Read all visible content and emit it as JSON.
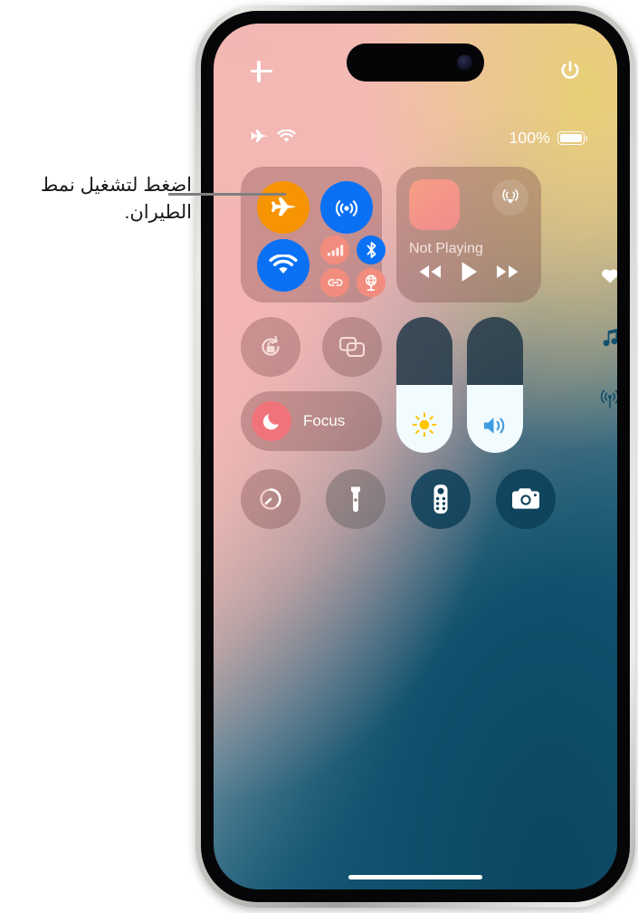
{
  "annotation": {
    "text": "اضغط لتشغيل نمط الطيران.",
    "leader_color": "#7f7f7f"
  },
  "device": {
    "name": "iPhone",
    "dynamic_island": "dynamic-island",
    "side_buttons": [
      "action-button",
      "volume-up-button",
      "volume-down-button",
      "side-button"
    ],
    "home_indicator": "home-indicator"
  },
  "screen": {
    "wallpaper_colors": {
      "top_left": "#f2b9b6",
      "top_right": "#e8cf76",
      "bottom_right": "#0c3f59",
      "mid_blue": "#2b6b86"
    }
  },
  "top_row": {
    "add_label": "+",
    "add_name": "add-controls-button",
    "power_name": "power-button"
  },
  "status_bar": {
    "airplane_icon": "airplane-icon",
    "wifi_icon": "wifi-icon",
    "battery_percent": "100%",
    "battery_icon": "battery-icon",
    "battery_level": 100
  },
  "connectivity": {
    "title": "connectivity-tile",
    "airplane": {
      "label": "Airplane Mode",
      "icon": "airplane-icon",
      "state": "on",
      "color": "#F69401"
    },
    "airdrop": {
      "label": "AirDrop",
      "icon": "airdrop-icon",
      "state": "on",
      "color": "#0A71F5"
    },
    "wifi": {
      "label": "Wi-Fi",
      "icon": "wifi-icon",
      "state": "on",
      "color": "#0A71F5"
    },
    "cellular": {
      "label": "Cellular Data",
      "icon": "cellular-bars-icon",
      "state": "off",
      "color": "#F28C7E"
    },
    "bluetooth": {
      "label": "Bluetooth",
      "icon": "bluetooth-icon",
      "state": "on",
      "color": "#0A71F5"
    },
    "hotspot": {
      "label": "Personal Hotspot",
      "icon": "hotspot-link-icon",
      "state": "off",
      "color": "#F28C7E"
    },
    "vpn": {
      "label": "VPN",
      "icon": "vpn-globe-icon",
      "state": "off",
      "color": "#F28C7E"
    }
  },
  "media": {
    "status_text": "Not Playing",
    "album_art": "album-art-placeholder",
    "airplay_icon": "airplay-icon",
    "rewind": "rewind-button",
    "play": "play-button",
    "forward": "fast-forward-button"
  },
  "controls": {
    "rotation_lock": {
      "label": "Rotation Lock",
      "icon": "rotation-lock-icon"
    },
    "screen_mirroring": {
      "label": "Screen Mirroring",
      "icon": "screen-mirroring-icon"
    },
    "focus": {
      "label": "Focus",
      "icon": "moon-icon",
      "accent": "#F0737A"
    },
    "timer": {
      "label": "Timer",
      "icon": "timer-icon"
    },
    "flashlight": {
      "label": "Flashlight",
      "icon": "flashlight-icon"
    },
    "remote": {
      "label": "Apple TV Remote",
      "icon": "tv-remote-icon"
    },
    "camera": {
      "label": "Camera",
      "icon": "camera-icon"
    }
  },
  "sliders": {
    "brightness": {
      "label": "Brightness",
      "icon": "sun-icon",
      "value": 50,
      "icon_color": "#FFC400"
    },
    "volume": {
      "label": "Volume",
      "icon": "speaker-icon",
      "value": 50,
      "icon_color": "#3E9BE0"
    }
  },
  "page_dots": [
    {
      "icon": "heart-icon",
      "label": "Home page",
      "active": true
    },
    {
      "icon": "music-note-icon",
      "label": "Media page",
      "active": false
    },
    {
      "icon": "broadcast-icon",
      "label": "Connectivity page",
      "active": false
    }
  ]
}
